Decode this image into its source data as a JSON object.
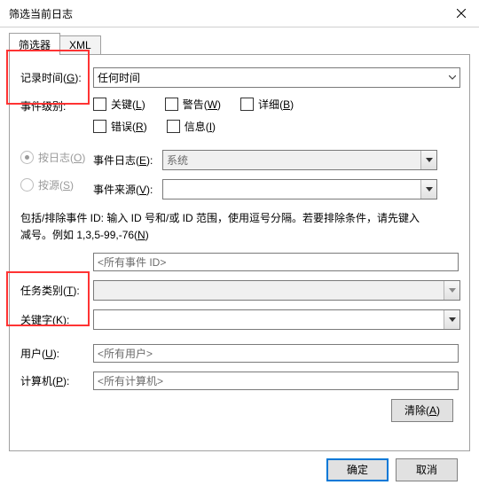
{
  "window": {
    "title": "筛选当前日志"
  },
  "tabs": {
    "filter": "筛选器",
    "xml": "XML"
  },
  "labels": {
    "logged": "记录时间",
    "logged_accel": "G",
    "level": "事件级别:",
    "by_log": "按日志",
    "by_log_accel": "O",
    "by_source": "按源",
    "by_source_accel": "S",
    "event_log": "事件日志",
    "event_log_accel": "E",
    "event_source": "事件来源",
    "event_source_accel": "V",
    "task": "任务类别",
    "task_accel": "T",
    "keyword": "关键字",
    "keyword_accel": "K",
    "user": "用户",
    "user_accel": "U",
    "computer": "计算机",
    "computer_accel": "P"
  },
  "dropdowns": {
    "logged_value": "任何时间",
    "event_log_value": "系统",
    "event_source_value": "",
    "task_value": "",
    "keyword_value": ""
  },
  "checkboxes": {
    "critical": "关键",
    "critical_accel": "L",
    "warning": "警告",
    "warning_accel": "W",
    "verbose": "详细",
    "verbose_accel": "B",
    "error": "错误",
    "error_accel": "R",
    "info": "信息",
    "info_accel": "I"
  },
  "info": {
    "line1": "包括/排除事件 ID: 输入 ID 号和/或 ID 范围，使用逗号分隔。若要排除条件，请先键入",
    "line2_a": "减号。例如 1,3,5-99,-76(",
    "line2_accel": "N",
    "line2_b": ")"
  },
  "inputs": {
    "event_id_placeholder": "<所有事件 ID>",
    "user_placeholder": "<所有用户>",
    "computer_placeholder": "<所有计算机>"
  },
  "buttons": {
    "clear": "清除",
    "clear_accel": "A",
    "ok": "确定",
    "cancel": "取消"
  }
}
